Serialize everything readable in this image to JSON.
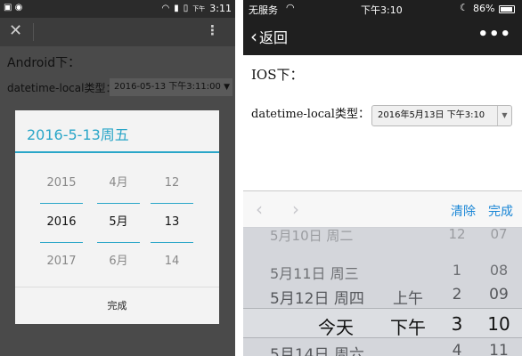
{
  "android": {
    "status": {
      "left_icons": [
        "image-icon",
        "chat-icon"
      ],
      "network": "下午",
      "time": "3:11"
    },
    "page_title": "Android下：",
    "field_label": "datetime-local类型：",
    "input_value": "2016-05-13 下午3:11:00",
    "dialog": {
      "title": "2016-5-13周五",
      "years": [
        "2015",
        "2016",
        "2017"
      ],
      "months": [
        "4月",
        "5月",
        "6月"
      ],
      "days": [
        "12",
        "13",
        "14"
      ],
      "done_label": "完成"
    },
    "accent_color": "#2aa6c8"
  },
  "ios": {
    "status": {
      "carrier": "无服务",
      "time": "下午3:10",
      "battery": "86%"
    },
    "nav": {
      "back_label": "返回",
      "menu_label": "•••"
    },
    "page_title": "IOS下：",
    "field_label": "datetime-local类型：",
    "select_value": "2016年5月13日 下午3:10",
    "toolbar": {
      "clear_label": "清除",
      "done_label": "完成"
    },
    "picker_rows": [
      {
        "date": "5月10日 周二",
        "ampm": "",
        "hour": "12",
        "minute": "07"
      },
      {
        "date": "5月11日 周三",
        "ampm": "",
        "hour": "1",
        "minute": "08"
      },
      {
        "date": "5月12日 周四",
        "ampm": "上午",
        "hour": "2",
        "minute": "09"
      },
      {
        "date": "今天",
        "ampm": "下午",
        "hour": "3",
        "minute": "10"
      },
      {
        "date": "5月14日 周六",
        "ampm": "",
        "hour": "4",
        "minute": "11"
      }
    ],
    "accent_color": "#1a86d6"
  }
}
